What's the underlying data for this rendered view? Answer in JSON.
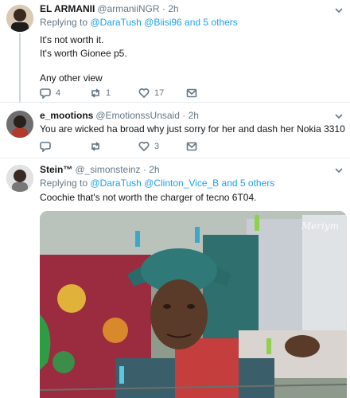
{
  "tweets": [
    {
      "name": "EL ARMANII",
      "handle": "@armaniiNGR · 2h",
      "reply_prefix": "Replying to",
      "mention1": "@DaraTush",
      "mention2": "@Biisi96",
      "reply_suffix": "and 5 others",
      "lines": [
        "It's not worth it.",
        "It's worth Gionee p5.",
        "Any other view"
      ],
      "replies": "4",
      "retweets": "1",
      "likes": "17"
    },
    {
      "name": "e_mootions",
      "handle": "@EmotionssUnsaid · 2h",
      "text": "You are wicked ha broad why just sorry for her and dash her Nokia 3310",
      "replies": "",
      "retweets": "",
      "likes": "3"
    },
    {
      "name": "Stein™",
      "handle": "@_simonsteinz · 2h",
      "reply_prefix": "Replying to",
      "mention1": "@DaraTush",
      "mention2": "@Clinton_Vice_B",
      "reply_suffix": "and 5 others",
      "text": "Coochie that's not worth the charger of tecno 6T04.",
      "media_watermark": "Meriym"
    }
  ],
  "icons": {
    "reply": "reply-icon",
    "retweet": "retweet-icon",
    "like": "heart-icon",
    "dm": "envelope-icon",
    "more": "chevron-down-icon"
  },
  "colors": {
    "link": "#1da1f2",
    "muted": "#657786"
  }
}
